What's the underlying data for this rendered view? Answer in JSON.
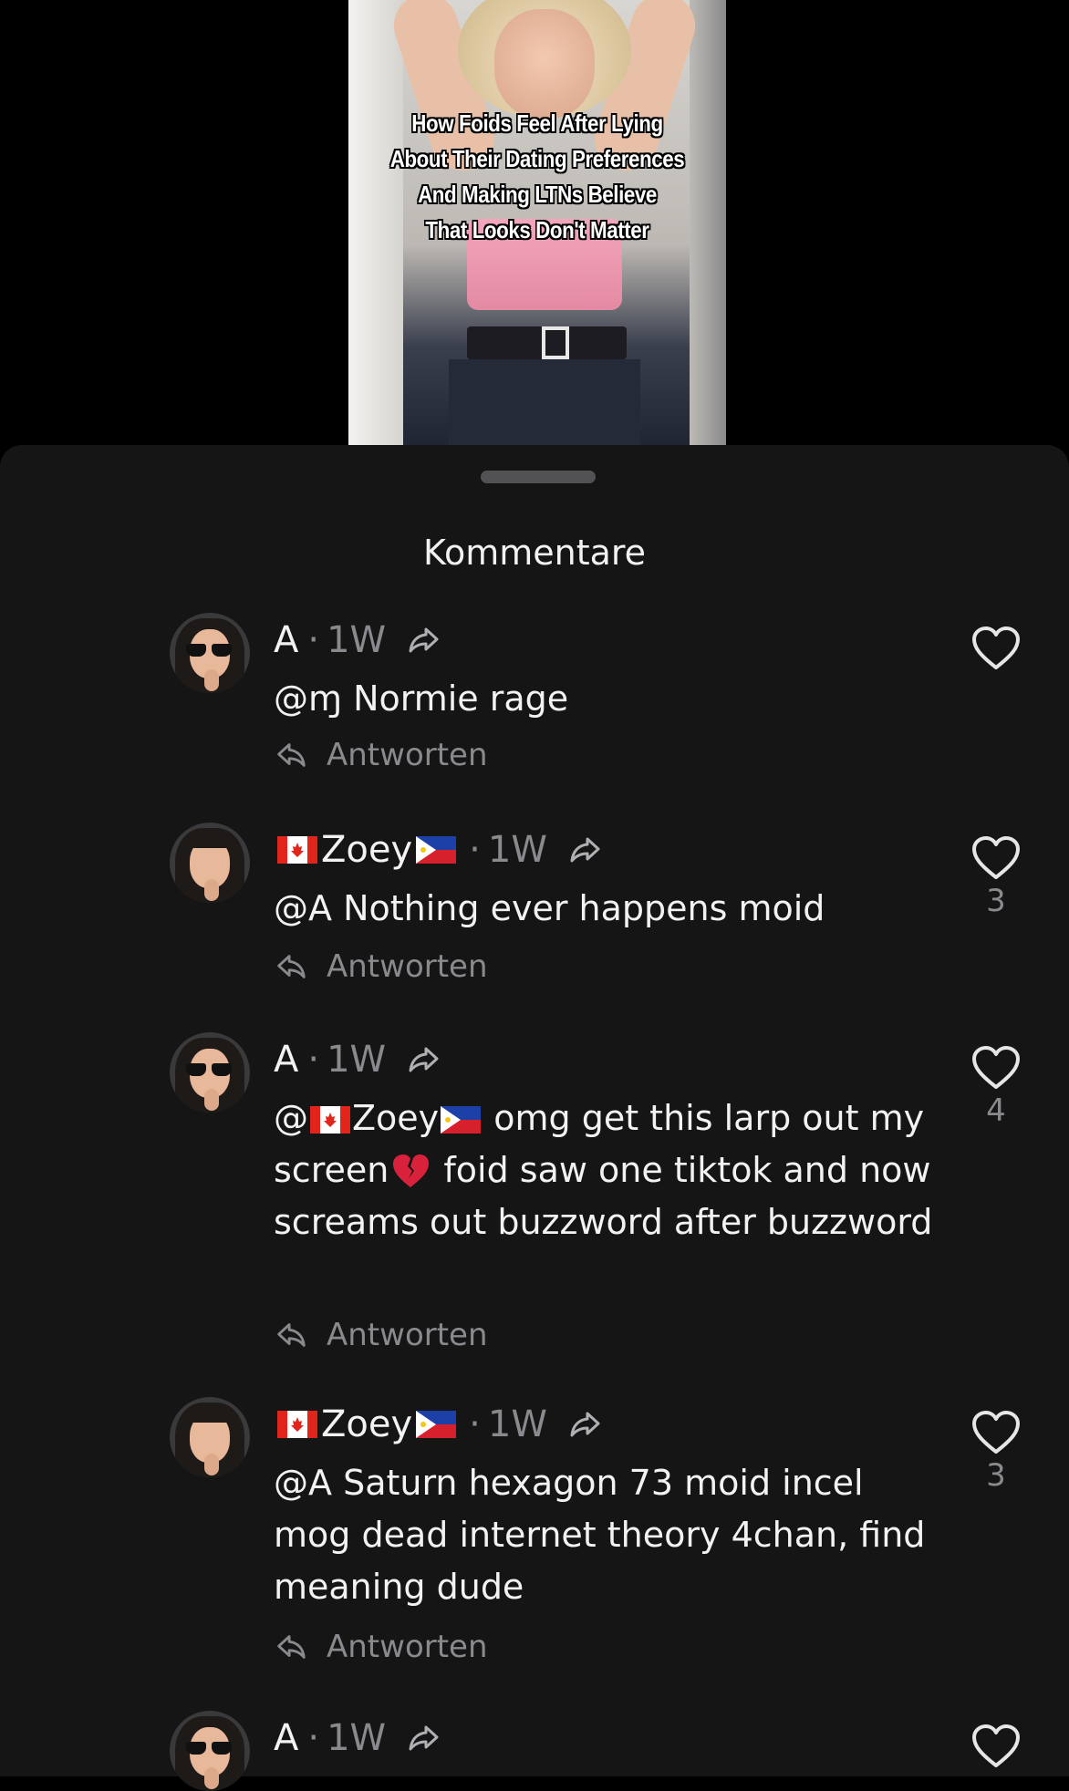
{
  "video": {
    "caption_lines": [
      "How Foids Feel After Lying",
      "About Their Dating Preferences",
      "And Making LTNs Believe",
      "That Looks Don't Matter"
    ]
  },
  "sheet": {
    "title": "Kommentare",
    "reply_label": "Antworten"
  },
  "comments": [
    {
      "author": "A",
      "author_flags": [],
      "time": "1W",
      "text": "@ɱ Normie rage",
      "likes": ""
    },
    {
      "author": "Zoey",
      "author_flags": [
        "canada-flag",
        "philippines-flag"
      ],
      "time": "1W",
      "text": "@A Nothing ever happens moid",
      "likes": "3"
    },
    {
      "author": "A",
      "author_flags": [],
      "time": "1W",
      "text_prefix": "@",
      "text_mention": "Zoey",
      "text_rest_1": " omg get this larp out my screen",
      "text_emoji": "broken-heart-icon",
      "text_rest_2": " foid saw one tiktok and now screams out buzzword after buzzword",
      "likes": "4"
    },
    {
      "author": "Zoey",
      "author_flags": [
        "canada-flag",
        "philippines-flag"
      ],
      "time": "1W",
      "text": "@A Saturn hexagon 73 moid incel mog dead internet theory 4chan, find meaning dude",
      "likes": "3"
    },
    {
      "author": "A",
      "author_flags": [],
      "time": "1W",
      "text": "",
      "likes": ""
    }
  ],
  "separator": "·",
  "colors": {
    "sheet_bg": "#151516",
    "muted_text": "#8a8a8e",
    "primary_text": "#f2f2f2"
  }
}
